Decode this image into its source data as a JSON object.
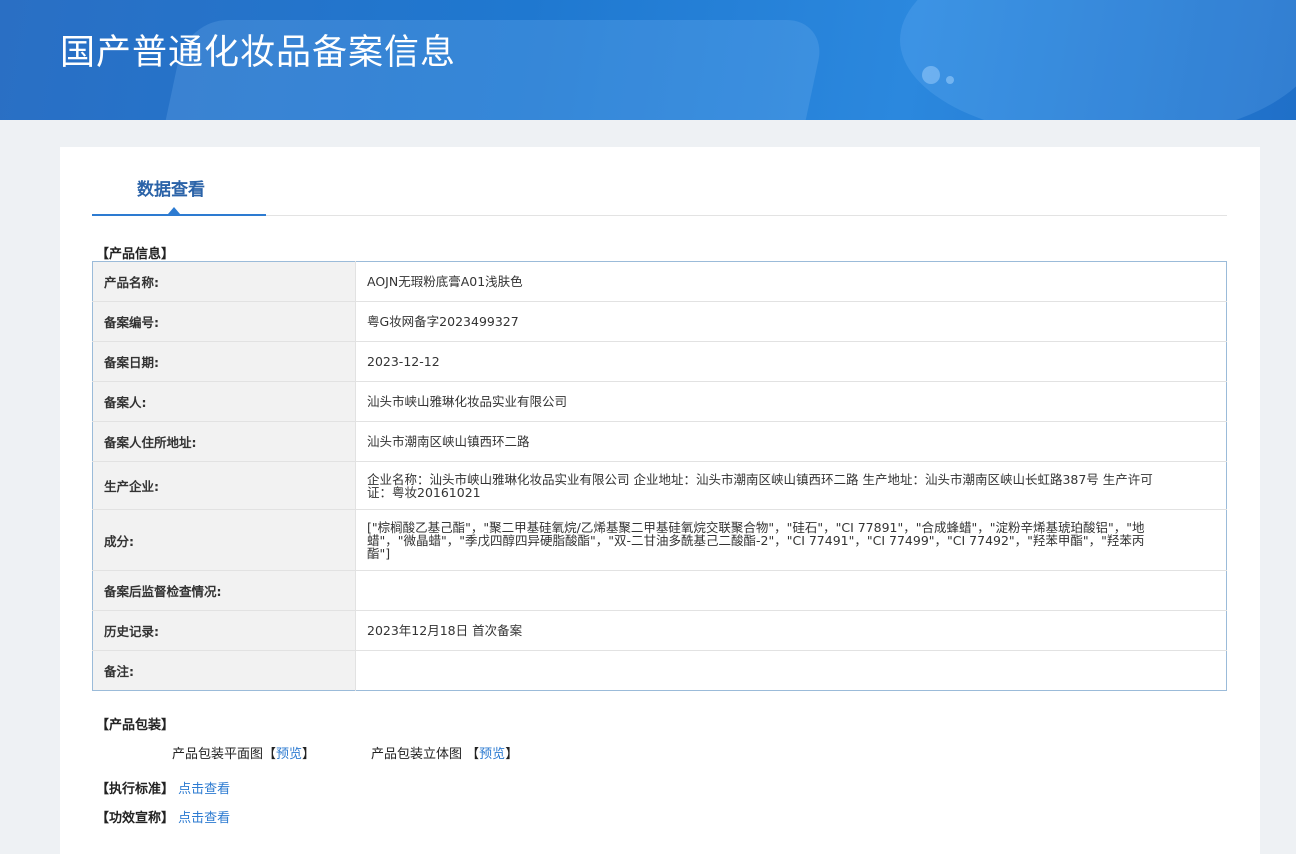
{
  "header": {
    "title": "国产普通化妆品备案信息"
  },
  "tabs": [
    {
      "label": "数据查看"
    }
  ],
  "product_info": {
    "section_title": "【产品信息】",
    "rows": [
      {
        "label": "产品名称:",
        "value": "AOJN无瑕粉底膏A01浅肤色"
      },
      {
        "label": "备案编号:",
        "value": "粤G妆网备字2023499327"
      },
      {
        "label": "备案日期:",
        "value": "2023-12-12"
      },
      {
        "label": "备案人:",
        "value": "汕头市峡山雅琳化妆品实业有限公司"
      },
      {
        "label": "备案人住所地址:",
        "value": "汕头市潮南区峡山镇西环二路"
      },
      {
        "label": "生产企业:",
        "value": "企业名称：汕头市峡山雅琳化妆品实业有限公司 企业地址：汕头市潮南区峡山镇西环二路 生产地址：汕头市潮南区峡山长虹路387号 生产许可证：粤妆20161021"
      },
      {
        "label": "成分:",
        "value": "[\"棕榈酸乙基己酯\"，\"聚二甲基硅氧烷/乙烯基聚二甲基硅氧烷交联聚合物\"，\"硅石\"，\"CI 77891\"，\"合成蜂蜡\"，\"淀粉辛烯基琥珀酸铝\"，\"地蜡\"，\"微晶蜡\"，\"季戊四醇四异硬脂酸酯\"，\"双-二甘油多酰基己二酸酯-2\"，\"CI 77491\"，\"CI 77499\"，\"CI 77492\"，\"羟苯甲酯\"，\"羟苯丙酯\"]"
      },
      {
        "label": "备案后监督检查情况:",
        "value": ""
      },
      {
        "label": "历史记录:",
        "value": "2023年12月18日 首次备案"
      },
      {
        "label": "备注:",
        "value": ""
      }
    ]
  },
  "packaging": {
    "section_title": "【产品包装】",
    "flat_label": "产品包装平面图",
    "solid_label": "产品包装立体图",
    "bracket_open": "【",
    "bracket_close": "】",
    "preview_link": "预览"
  },
  "standard": {
    "label": "【执行标准】",
    "link": "点击查看"
  },
  "efficacy": {
    "label": "【功效宣称】",
    "link": "点击查看"
  }
}
